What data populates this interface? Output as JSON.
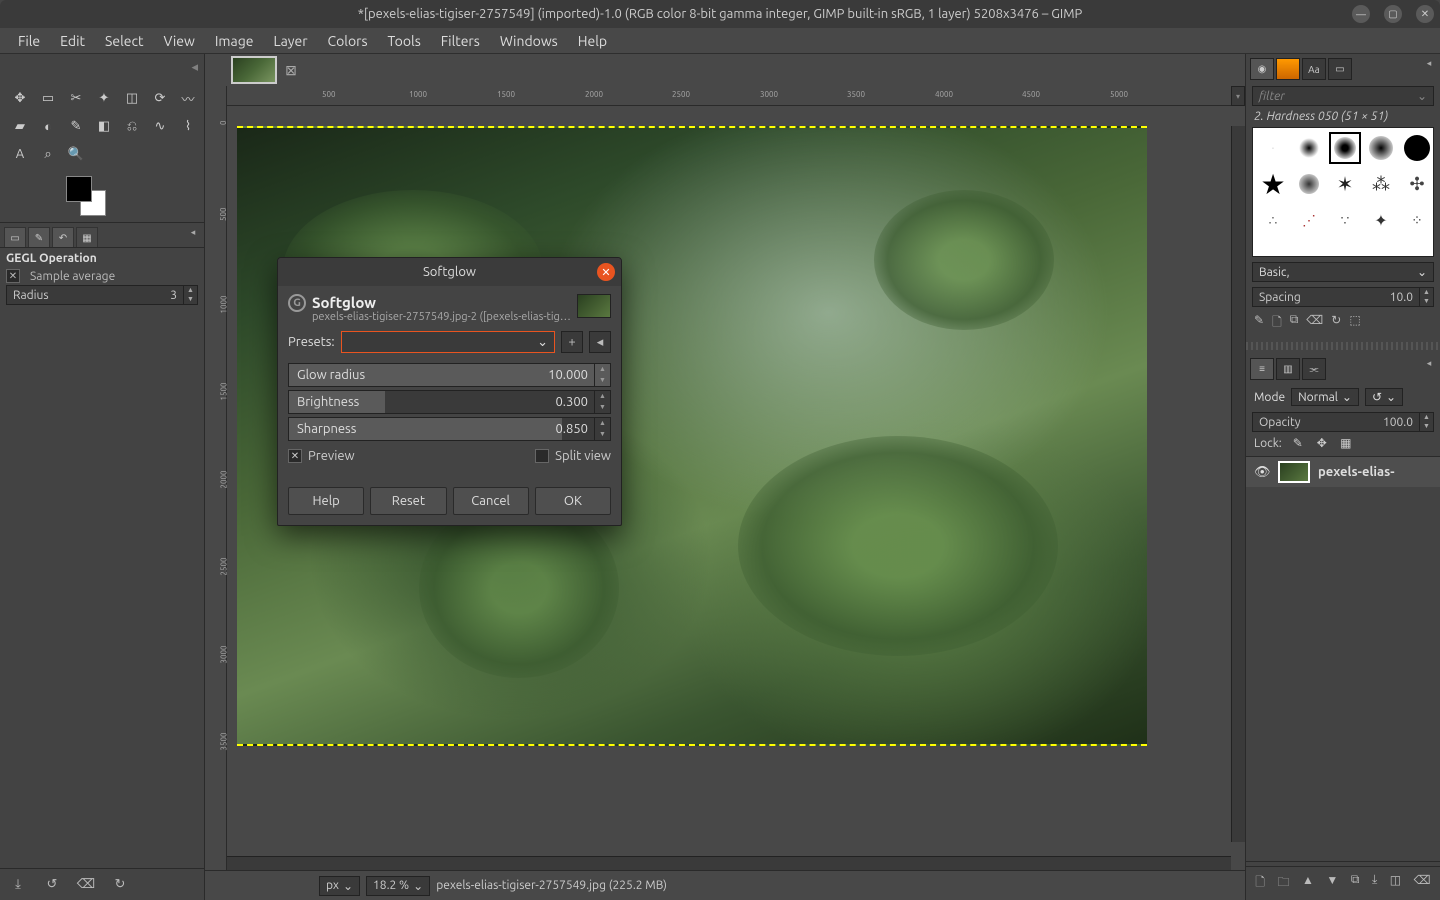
{
  "window": {
    "title": "*[pexels-elias-tigiser-2757549] (imported)-1.0 (RGB color 8-bit gamma integer, GIMP built-in sRGB, 1 layer) 5208x3476 – GIMP"
  },
  "menu": [
    "File",
    "Edit",
    "Select",
    "View",
    "Image",
    "Layer",
    "Colors",
    "Tools",
    "Filters",
    "Windows",
    "Help"
  ],
  "toolbox": {
    "tools": [
      "move",
      "rect-select",
      "free-select",
      "fuzzy-select",
      "scissors",
      "warp",
      "bucket",
      "gradient",
      "pencil",
      "eraser",
      "clone",
      "smudge",
      "crop",
      "text",
      "color-picker",
      "zoom"
    ],
    "fg": "#000000",
    "bg": "#ffffff"
  },
  "tool_options": {
    "title": "GEGL Operation",
    "sample_average_label": "Sample average",
    "sample_average_checked": true,
    "radius_label": "Radius",
    "radius_value": "3"
  },
  "hruler_ticks": [
    {
      "pos": 95,
      "label": "500"
    },
    {
      "pos": 182,
      "label": "1000"
    },
    {
      "pos": 270,
      "label": "1500"
    },
    {
      "pos": 358,
      "label": "2000"
    },
    {
      "pos": 445,
      "label": "2500"
    },
    {
      "pos": 533,
      "label": "3000"
    },
    {
      "pos": 620,
      "label": "3500"
    },
    {
      "pos": 708,
      "label": "4000"
    },
    {
      "pos": 795,
      "label": "4500"
    },
    {
      "pos": 883,
      "label": "5000"
    }
  ],
  "vruler_ticks": [
    {
      "pos": 30,
      "label": "0"
    },
    {
      "pos": 117,
      "label": "500"
    },
    {
      "pos": 205,
      "label": "1000"
    },
    {
      "pos": 292,
      "label": "1500"
    },
    {
      "pos": 380,
      "label": "2000"
    },
    {
      "pos": 467,
      "label": "2500"
    },
    {
      "pos": 555,
      "label": "3000"
    },
    {
      "pos": 642,
      "label": "3500"
    }
  ],
  "status": {
    "unit": "px",
    "zoom": "18.2 %",
    "file_info": "pexels-elias-tigiser-2757549.jpg (225.2 MB)"
  },
  "brushes": {
    "filter_placeholder": "filter",
    "current": "2. Hardness 050 (51 × 51)",
    "preset_group": "Basic,",
    "spacing_label": "Spacing",
    "spacing_value": "10.0"
  },
  "layers": {
    "mode_label": "Mode",
    "mode_value": "Normal",
    "opacity_label": "Opacity",
    "opacity_value": "100.0",
    "lock_label": "Lock:",
    "layer_name": "pexels-elias-"
  },
  "dialog": {
    "title": "Softglow",
    "heading": "Softglow",
    "subtitle": "pexels-elias-tigiser-2757549.jpg-2 ([pexels-elias-tig…",
    "presets_label": "Presets:",
    "params": {
      "glow_radius": {
        "label": "Glow radius",
        "value": "10.000",
        "fill_pct": 100
      },
      "brightness": {
        "label": "Brightness",
        "value": "0.300",
        "fill_pct": 30
      },
      "sharpness": {
        "label": "Sharpness",
        "value": "0.850",
        "fill_pct": 85
      }
    },
    "preview_label": "Preview",
    "preview_checked": true,
    "split_label": "Split view",
    "split_checked": false,
    "buttons": {
      "help": "Help",
      "reset": "Reset",
      "cancel": "Cancel",
      "ok": "OK"
    }
  }
}
